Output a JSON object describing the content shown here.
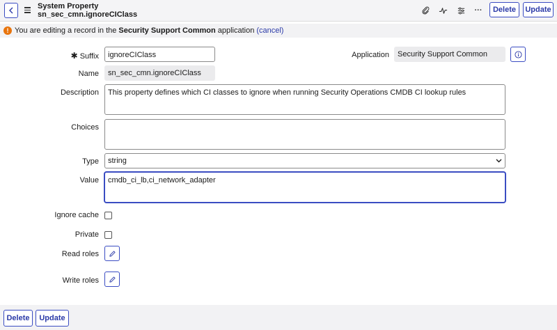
{
  "header": {
    "title_line1": "System Property",
    "title_line2": "sn_sec_cmn.ignoreCIClass",
    "delete_label": "Delete",
    "update_label": "Update",
    "more_label": "···"
  },
  "notice": {
    "prefix": "You are editing a record in the",
    "app_name": "Security Support Common",
    "suffix": "application",
    "cancel_label": "(cancel)"
  },
  "form": {
    "suffix_label": "Suffix",
    "suffix_value": "ignoreCIClass",
    "application_label": "Application",
    "application_value": "Security Support Common",
    "name_label": "Name",
    "name_value": "sn_sec_cmn.ignoreCIClass",
    "description_label": "Description",
    "description_value": "This property defines which CI classes to ignore when running Security Operations CMDB CI lookup rules",
    "choices_label": "Choices",
    "choices_value": "",
    "type_label": "Type",
    "type_value": "string",
    "value_label": "Value",
    "value_value": "cmdb_ci_lb,ci_network_adapter",
    "ignore_cache_label": "Ignore cache",
    "private_label": "Private",
    "read_roles_label": "Read roles",
    "write_roles_label": "Write roles"
  },
  "footer": {
    "delete_label": "Delete",
    "update_label": "Update"
  },
  "colors": {
    "accent": "#3a4cc2",
    "warning": "#e8740c"
  }
}
